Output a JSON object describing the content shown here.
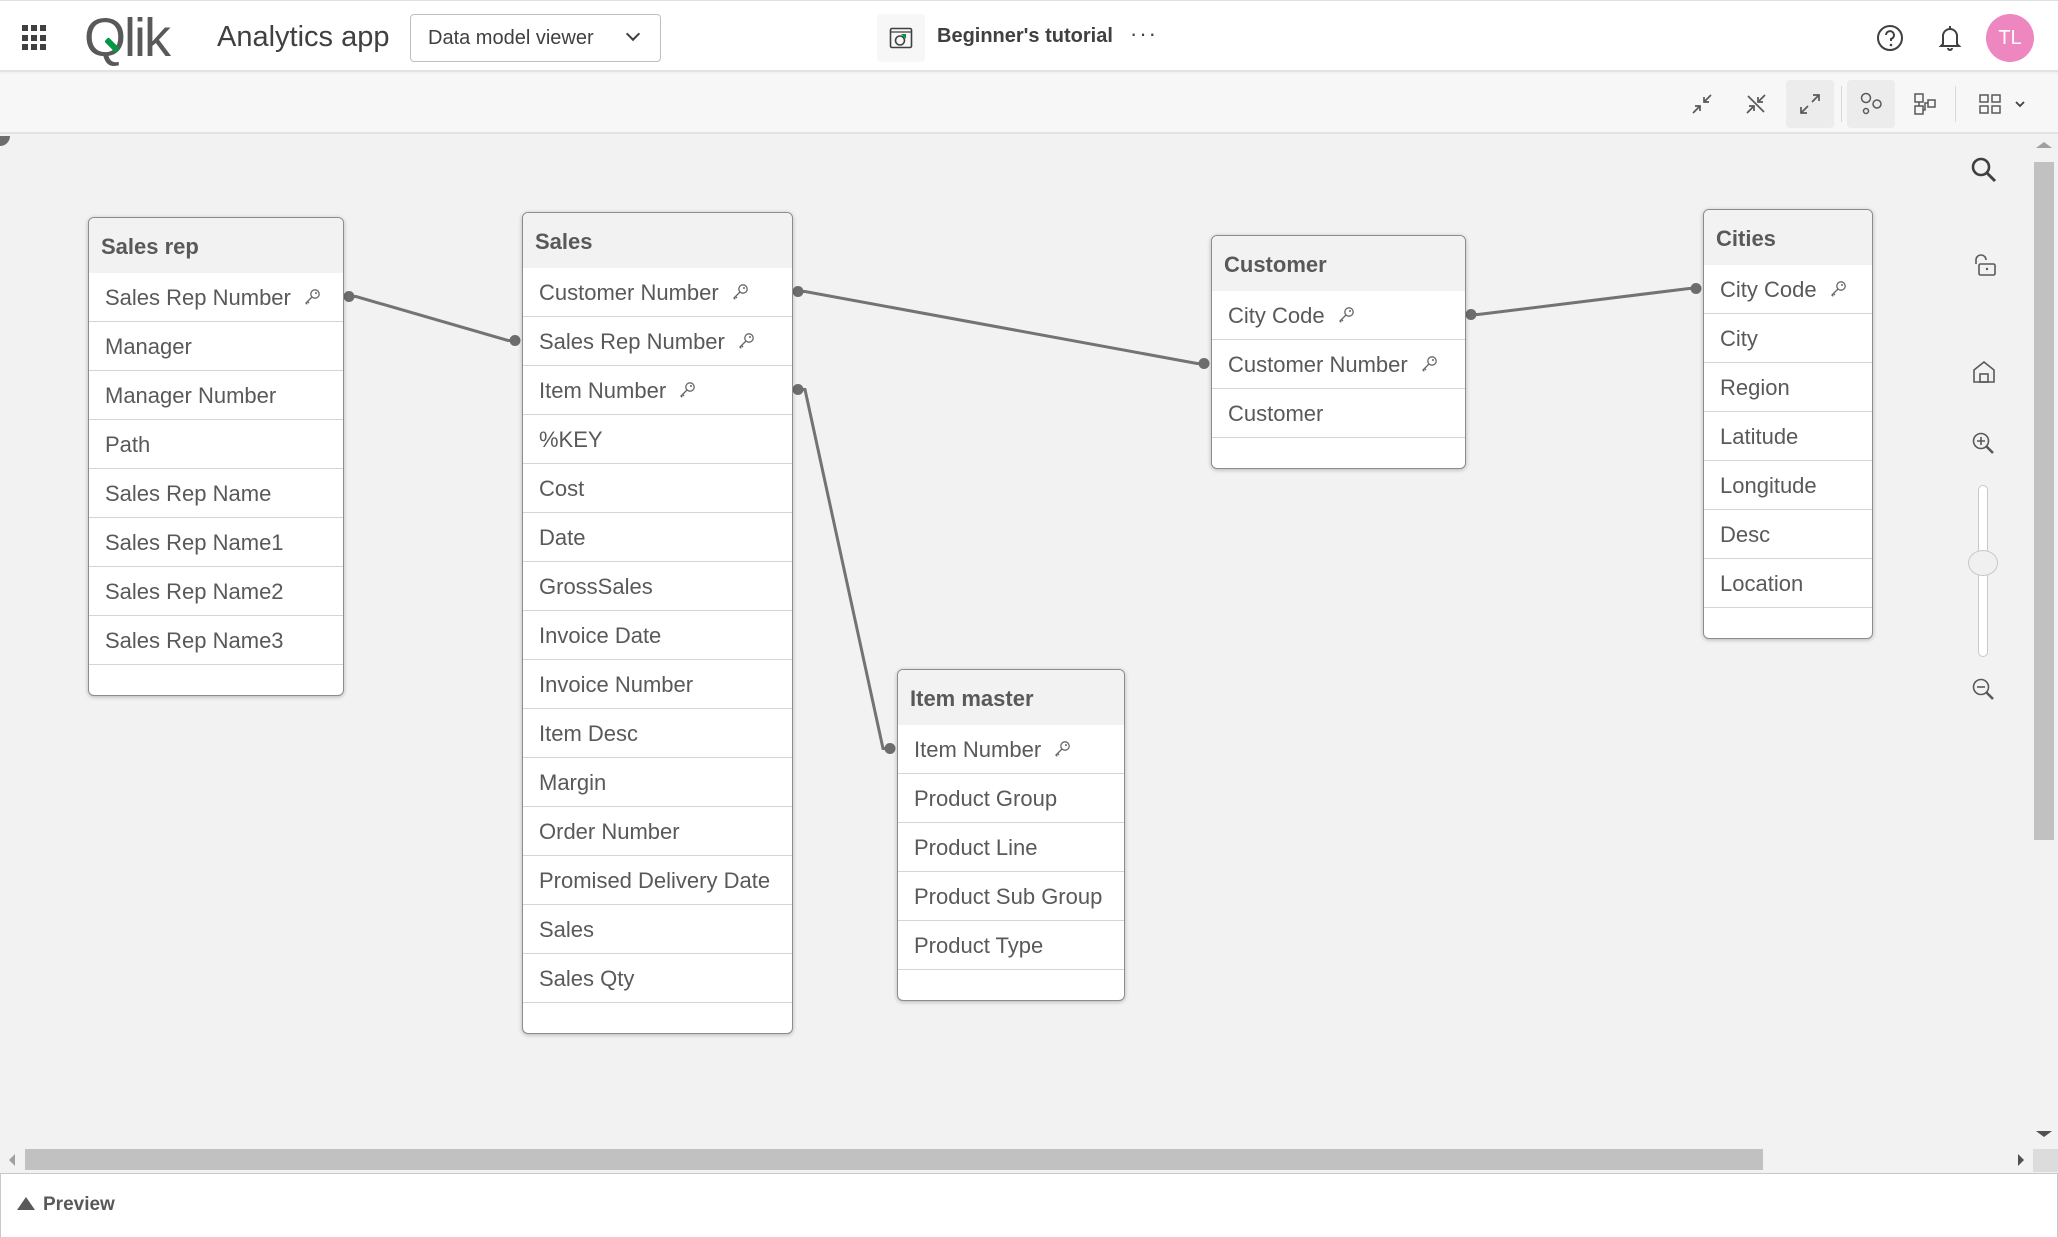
{
  "header": {
    "logo_text": "Qlik",
    "app_name": "Analytics app",
    "nav_select": "Data model viewer",
    "sheet_title": "Beginner's tutorial",
    "more_label": "···",
    "avatar_initials": "TL",
    "avatar_color": "#ee86bf",
    "icons": [
      "apps-grid-icon",
      "help-icon",
      "bell-icon"
    ]
  },
  "toolbar": {
    "buttons": [
      {
        "name": "collapse-all",
        "icon": "collapse-icon"
      },
      {
        "name": "show-linked",
        "icon": "linked-collapse-icon"
      },
      {
        "name": "expand-all",
        "icon": "expand-icon",
        "active": true
      },
      {
        "name": "internal-table-view",
        "icon": "bubbles-icon",
        "active": true
      },
      {
        "name": "source-table-view",
        "icon": "source-table-icon"
      },
      {
        "name": "layout",
        "icon": "grid-layout-icon"
      }
    ]
  },
  "tables": [
    {
      "name": "Sales rep",
      "fields": [
        {
          "label": "Sales Rep Number",
          "key": true
        },
        {
          "label": "Manager"
        },
        {
          "label": "Manager Number"
        },
        {
          "label": "Path"
        },
        {
          "label": "Sales Rep Name"
        },
        {
          "label": "Sales Rep Name1"
        },
        {
          "label": "Sales Rep Name2"
        },
        {
          "label": "Sales Rep Name3"
        }
      ]
    },
    {
      "name": "Sales",
      "fields": [
        {
          "label": "Customer Number",
          "key": true
        },
        {
          "label": "Sales Rep Number",
          "key": true
        },
        {
          "label": "Item Number",
          "key": true
        },
        {
          "label": "%KEY"
        },
        {
          "label": "Cost"
        },
        {
          "label": "Date"
        },
        {
          "label": "GrossSales"
        },
        {
          "label": "Invoice Date"
        },
        {
          "label": "Invoice Number"
        },
        {
          "label": "Item Desc"
        },
        {
          "label": "Margin"
        },
        {
          "label": "Order Number"
        },
        {
          "label": "Promised Delivery Date"
        },
        {
          "label": "Sales"
        },
        {
          "label": "Sales Qty"
        }
      ]
    },
    {
      "name": "Customer",
      "fields": [
        {
          "label": "City Code",
          "key": true
        },
        {
          "label": "Customer Number",
          "key": true
        },
        {
          "label": "Customer"
        }
      ]
    },
    {
      "name": "Cities",
      "fields": [
        {
          "label": "City Code",
          "key": true
        },
        {
          "label": "City"
        },
        {
          "label": "Region"
        },
        {
          "label": "Latitude"
        },
        {
          "label": "Longitude"
        },
        {
          "label": "Desc"
        },
        {
          "label": "Location"
        }
      ]
    },
    {
      "name": "Item master",
      "fields": [
        {
          "label": "Item Number",
          "key": true
        },
        {
          "label": "Product Group"
        },
        {
          "label": "Product Line"
        },
        {
          "label": "Product Sub Group"
        },
        {
          "label": "Product Type"
        }
      ]
    }
  ],
  "associations": [
    {
      "from": "Sales rep",
      "to": "Sales",
      "field": "Sales Rep Number"
    },
    {
      "from": "Sales",
      "to": "Customer",
      "field": "Customer Number"
    },
    {
      "from": "Sales",
      "to": "Item master",
      "field": "Item Number"
    },
    {
      "from": "Customer",
      "to": "Cities",
      "field": "City Code"
    }
  ],
  "side_tools": [
    "search-icon",
    "lock-icon",
    "home-icon",
    "zoom-in-icon",
    "zoom-out-icon"
  ],
  "zoom_level_fraction": 0.5,
  "preview": {
    "label": "Preview"
  }
}
